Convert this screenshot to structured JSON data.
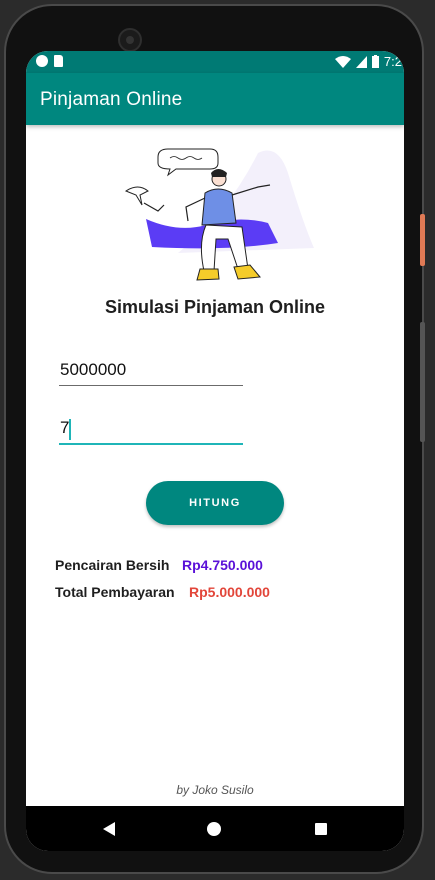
{
  "status_bar": {
    "time": "7:2",
    "icons": [
      "app-notification-icon",
      "sd-card-icon",
      "wifi-icon",
      "signal-icon",
      "battery-icon"
    ]
  },
  "app_bar": {
    "title": "Pinjaman Online"
  },
  "main": {
    "heading": "Simulasi Pinjaman Online",
    "amount_input": {
      "value": "5000000"
    },
    "tenor_input": {
      "value": "7"
    },
    "calculate_button": "HITUNG",
    "results": {
      "net_disbursement_label": "Pencairan Bersih",
      "net_disbursement_value": "Rp4.750.000",
      "total_payment_label": "Total Pembayaran",
      "total_payment_value": "Rp5.000.000"
    }
  },
  "footer": {
    "credit": "by Joko Susilo"
  },
  "colors": {
    "primary": "#00877f",
    "status_bar": "#007a74",
    "accent": "#1fb5b8",
    "net_value": "#5a10d8",
    "total_value": "#e2463a"
  }
}
